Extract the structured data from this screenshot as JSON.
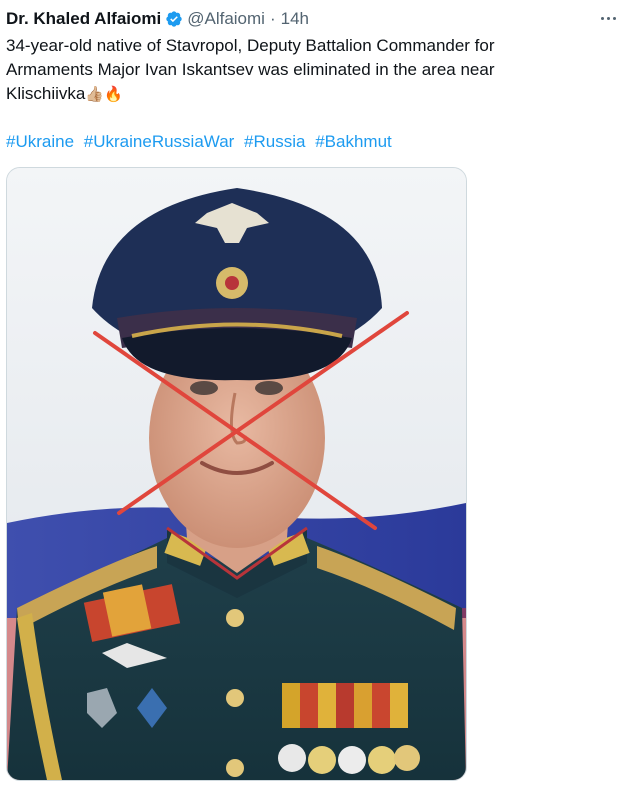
{
  "tweet": {
    "author_name": "Dr. Khaled Alfaiomi",
    "author_handle": "@Alfaiomi",
    "separator": "·",
    "timestamp": "14h",
    "text_line1": "34-year-old native of Stavropol, Deputy Battalion Commander for",
    "text_line2": "Armaments Major Ivan Iskantsev was eliminated in the area near",
    "text_line3": "Klischiivka",
    "emojis": "👍🏼🔥",
    "hashtags": [
      "#Ukraine",
      "#UkraineRussiaWar",
      "#Russia",
      "#Bakhmut"
    ]
  },
  "icons": {
    "verified": "verified-badge-icon",
    "more": "more-horizontal-icon"
  },
  "colors": {
    "link": "#1d9bf0",
    "verified_badge": "#1d9bf0",
    "muted_text": "#536471",
    "cross_mark": "#e0463c"
  }
}
